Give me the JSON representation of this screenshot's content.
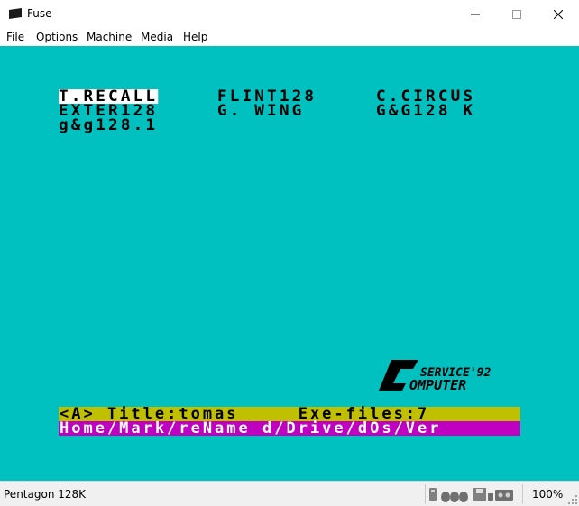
{
  "window": {
    "title": "Fuse",
    "icon": "app-icon",
    "controls": [
      "minimize-icon",
      "maximize-icon",
      "close-icon"
    ]
  },
  "menu": {
    "items": [
      {
        "label": "File"
      },
      {
        "label": "Options"
      },
      {
        "label": "Machine"
      },
      {
        "label": "Media"
      },
      {
        "label": "Help"
      }
    ]
  },
  "screen": {
    "colors": {
      "background": "#00c0c0",
      "selected": "#ffffff",
      "yellow_bar": "#c0c000",
      "magenta_bar": "#c000c0"
    },
    "files": {
      "col1": [
        "T.RECALL",
        "EXTER128",
        "g&g128.1"
      ],
      "col2": [
        "FLINT128",
        "G. WING"
      ],
      "col3": [
        "C.CIRCUS",
        "G&G128 K"
      ],
      "selected": "T.RECALL"
    },
    "status_line": "<A> Title:tomas     Exe-files:7",
    "help_line": "Home/Mark/reName d/Drive/dOs/Ver",
    "logo": {
      "line1": "SERVICE'92",
      "line2": "OMPUTER"
    }
  },
  "statusbar": {
    "machine": "Pentagon 128K",
    "icons": [
      "keyboard-icon",
      "mouse-icon",
      "microdrive-icon",
      "disk-icon",
      "tape-icon"
    ],
    "zoom": "100%"
  }
}
